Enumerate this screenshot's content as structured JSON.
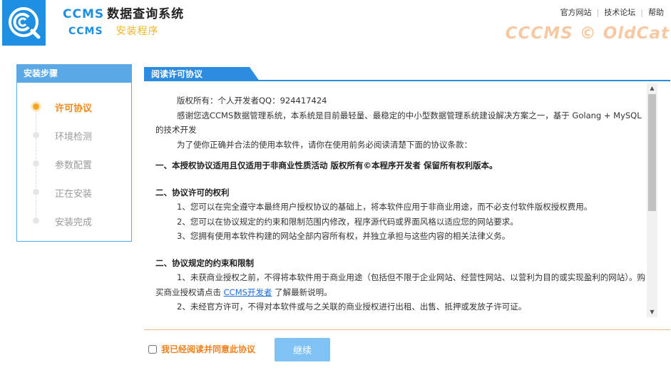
{
  "header": {
    "app_name_latin": "CCMS",
    "app_name_cn": "数据查询系统",
    "sub_latin": "CCMS",
    "sub_cn": "安装程序",
    "links": [
      "官方网站",
      "技术论坛",
      "帮助"
    ],
    "brand": "CCCMS © OldCat",
    "logo_icon": "ccms-logo-icon"
  },
  "sidebar": {
    "title": "安装步骤",
    "steps": [
      {
        "label": "许可协议",
        "active": true
      },
      {
        "label": "环境检测",
        "active": false
      },
      {
        "label": "参数配置",
        "active": false
      },
      {
        "label": "正在安装",
        "active": false
      },
      {
        "label": "安装完成",
        "active": false
      }
    ]
  },
  "main": {
    "tab": "阅读许可协议",
    "license": {
      "copyright": "版权所有：个人开发者QQ：924417424",
      "intro": "感谢您选CCMS数据管理系统，本系统是目前最轻量、最稳定的中小型数据管理系统建设解决方案之一，基于 Golang + MySQL 的技术开发",
      "notice": "为了使你正确并合法的使用本软件，请你在使用前务必阅读清楚下面的协议条款：",
      "s1": "一、本授权协议适用且仅适用于非商业性质活动 版权所有©本程序开发者 保留所有权利版本。",
      "s2_title": "二、协议许可的权利",
      "s2_1": "1、您可以在完全遵守本最终用户授权协议的基础上，将本软件应用于非商业用途，而不必支付软件版权授权费用。",
      "s2_2": "2、您可以在协议规定的约束和限制范围内修改，程序源代码或界面风格以适应您的网站要求。",
      "s2_3": "3、您拥有使用本软件构建的网站全部内容所有权，并独立承担与这些内容的相关法律义务。",
      "s3_title": "二、协议规定的约束和限制",
      "s3_1a": "1、未获商业授权之前，不得将本软件用于商业用途（包括但不限于企业网站、经营性网站、以营利为目的或实现盈利的网站）。购买商业授权请点击 ",
      "s3_1_link": "CCMS开发者",
      "s3_1b": " 了解最新说明。",
      "s3_2": "2、未经官方许可，不得对本软件或与之关联的商业授权进行出租、出售、抵押或发放子许可证。"
    },
    "agree_label": "我已经阅读并同意此协议",
    "agree_checked": false,
    "continue_label": "继续"
  }
}
